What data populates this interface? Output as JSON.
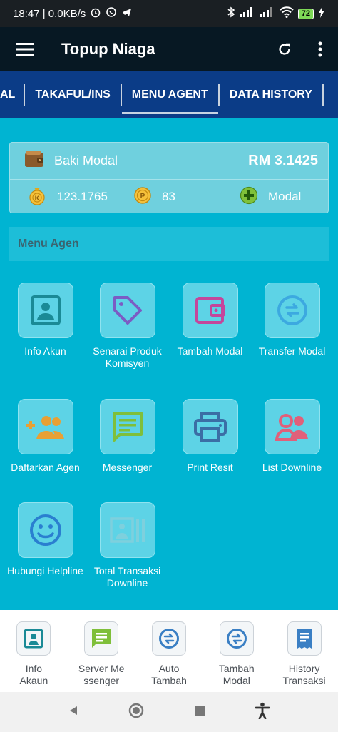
{
  "status_bar": {
    "time_speed": "18:47 | 0.0KB/s",
    "battery": "72"
  },
  "app_bar": {
    "title": "Topup Niaga"
  },
  "tabs": [
    {
      "label": "AL"
    },
    {
      "label": "TAKAFUL/INS"
    },
    {
      "label": "MENU AGENT",
      "active": true
    },
    {
      "label": "DATA HISTORY"
    }
  ],
  "balance": {
    "label": "Baki Modal",
    "amount": "RM 3.1425",
    "komisyen_points": "123.1765",
    "points": "83",
    "modal_label": "Modal"
  },
  "section": {
    "title": "Menu Agen"
  },
  "menu": [
    {
      "label": "Info Akun",
      "icon": "account-box-icon",
      "color": "#1a8a96"
    },
    {
      "label": "Senarai Produk Komisyen",
      "icon": "tag-icon",
      "color": "#7b5cc4"
    },
    {
      "label": "Tambah Modal",
      "icon": "wallet-icon",
      "color": "#c4469b"
    },
    {
      "label": "Transfer Modal",
      "icon": "transfer-icon",
      "color": "#3ca9e0"
    },
    {
      "label": "Daftarkan Agen",
      "icon": "add-group-icon",
      "color": "#e8a034"
    },
    {
      "label": "Messenger",
      "icon": "message-icon",
      "color": "#7fbf3a"
    },
    {
      "label": "Print Resit",
      "icon": "printer-icon",
      "color": "#3b6ea5"
    },
    {
      "label": "List Downline",
      "icon": "people-icon",
      "color": "#e0607a"
    },
    {
      "label": "Hubungi Helpline",
      "icon": "smile-icon",
      "color": "#2a7fd0"
    },
    {
      "label": "Total Transaksi Downline",
      "icon": "report-icon",
      "color": "#7ed0dd"
    }
  ],
  "bottom_nav": [
    {
      "label_1": "Info",
      "label_2": "Akaun",
      "icon": "account-box-icon"
    },
    {
      "label_1": "Server Me",
      "label_2": "ssenger",
      "icon": "message-icon"
    },
    {
      "label_1": "Auto",
      "label_2": "Tambah",
      "icon": "transfer-icon"
    },
    {
      "label_1": "Tambah",
      "label_2": "Modal",
      "icon": "transfer-icon"
    },
    {
      "label_1": "History",
      "label_2": "Transaksi",
      "icon": "receipt-icon"
    }
  ],
  "colors": {
    "background": "#00b4d2",
    "app_bar": "#071823",
    "tab_bar": "#0b3c87"
  }
}
